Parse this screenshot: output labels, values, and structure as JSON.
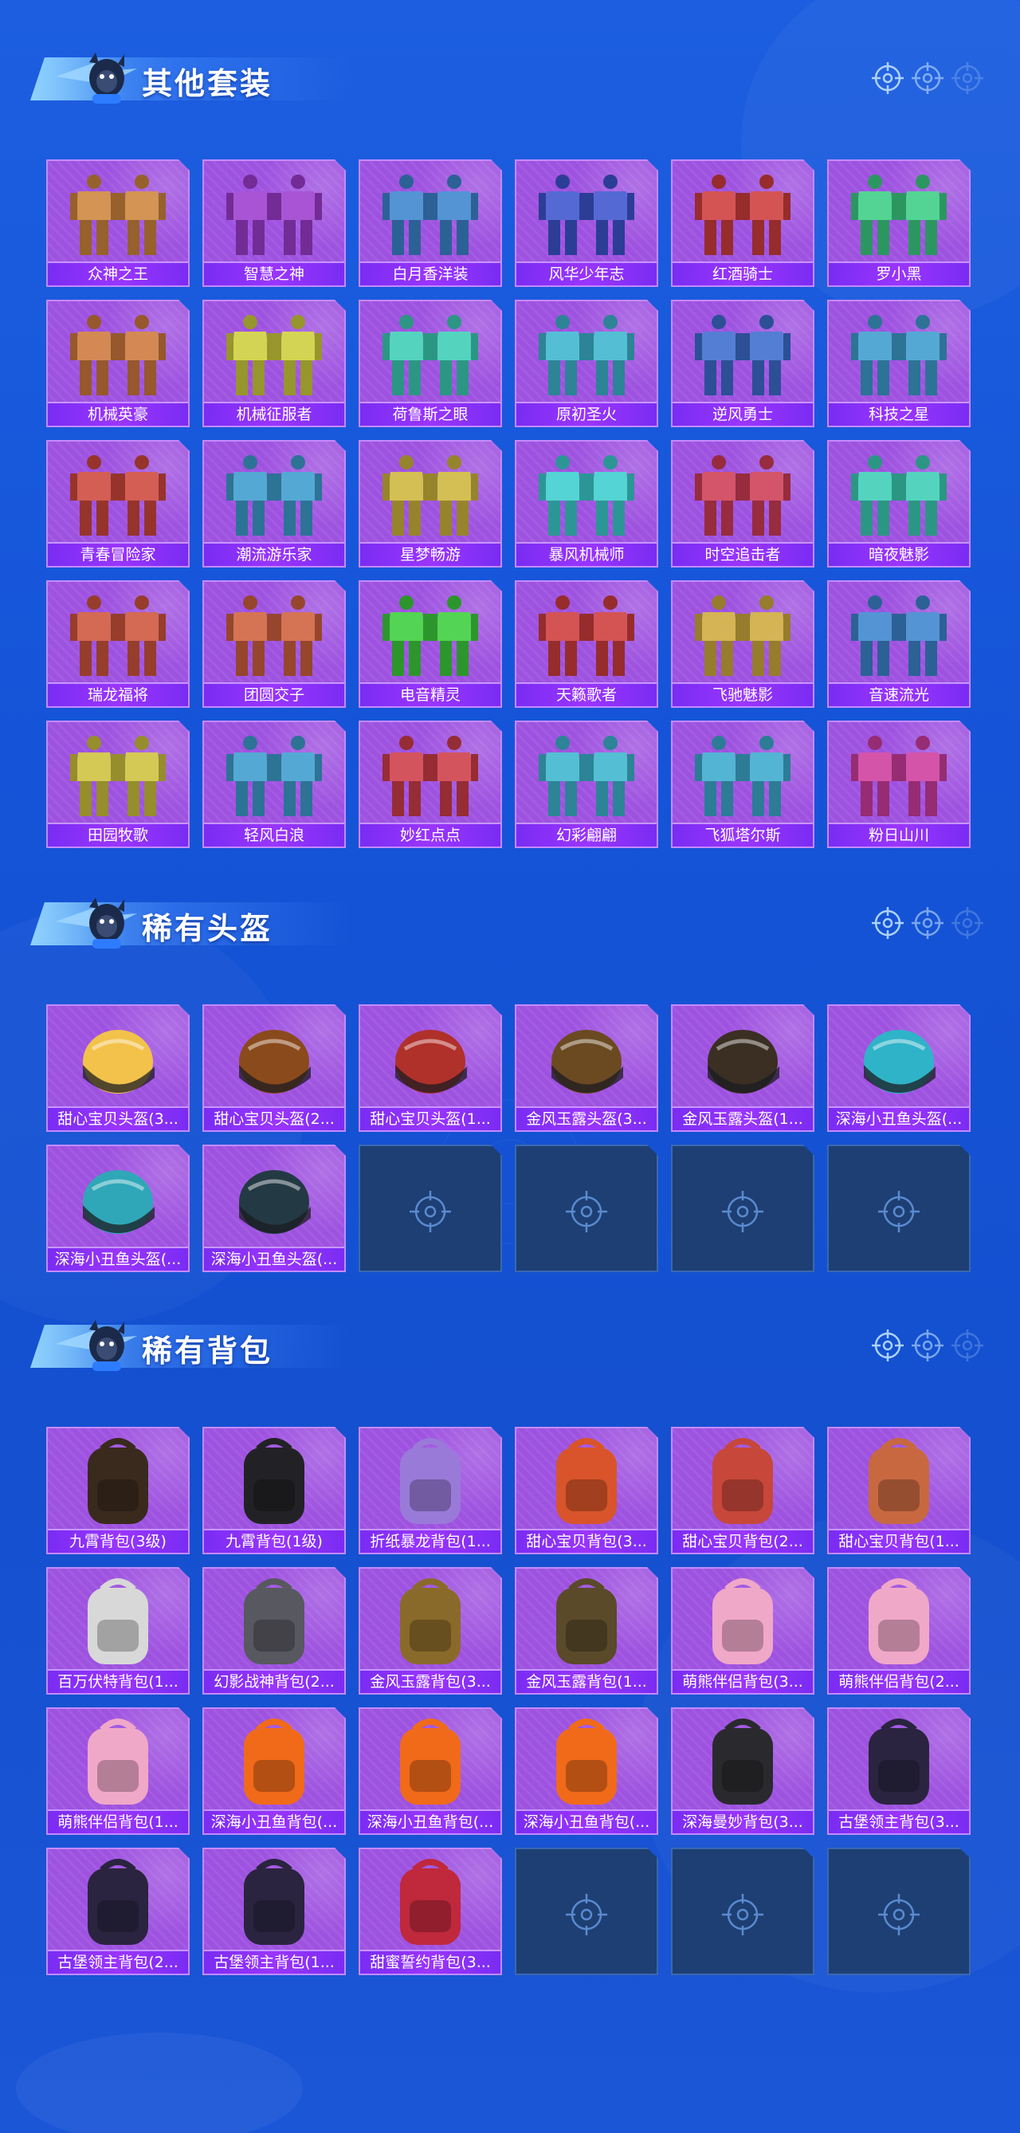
{
  "colors": {
    "background": "#1554d8",
    "card": "#9e52e0",
    "label_bar": "#8a30f8",
    "empty_slot": "#1e3f73"
  },
  "sections": [
    {
      "title": "其他套装",
      "items": [
        {
          "name": "众神之王",
          "art": "outfit"
        },
        {
          "name": "智慧之神",
          "art": "outfit"
        },
        {
          "name": "白月香洋装",
          "art": "outfit"
        },
        {
          "name": "风华少年志",
          "art": "outfit"
        },
        {
          "name": "红酒骑士",
          "art": "outfit"
        },
        {
          "name": "罗小黑",
          "art": "outfit"
        },
        {
          "name": "机械英豪",
          "art": "outfit"
        },
        {
          "name": "机械征服者",
          "art": "outfit"
        },
        {
          "name": "荷鲁斯之眼",
          "art": "outfit"
        },
        {
          "name": "原初圣火",
          "art": "outfit"
        },
        {
          "name": "逆风勇士",
          "art": "outfit"
        },
        {
          "name": "科技之星",
          "art": "outfit"
        },
        {
          "name": "青春冒险家",
          "art": "outfit"
        },
        {
          "name": "潮流游乐家",
          "art": "outfit"
        },
        {
          "name": "星梦畅游",
          "art": "outfit"
        },
        {
          "name": "暴风机械师",
          "art": "outfit"
        },
        {
          "name": "时空追击者",
          "art": "outfit"
        },
        {
          "name": "暗夜魅影",
          "art": "outfit"
        },
        {
          "name": "瑞龙福将",
          "art": "outfit"
        },
        {
          "name": "团圆交子",
          "art": "outfit"
        },
        {
          "name": "电音精灵",
          "art": "outfit"
        },
        {
          "name": "天籁歌者",
          "art": "outfit"
        },
        {
          "name": "飞驰魅影",
          "art": "outfit"
        },
        {
          "name": "音速流光",
          "art": "outfit"
        },
        {
          "name": "田园牧歌",
          "art": "outfit"
        },
        {
          "name": "轻风白浪",
          "art": "outfit"
        },
        {
          "name": "妙红点点",
          "art": "outfit"
        },
        {
          "name": "幻彩翩翩",
          "art": "outfit"
        },
        {
          "name": "飞狐塔尔斯",
          "art": "outfit"
        },
        {
          "name": "粉日山川",
          "art": "outfit"
        }
      ]
    },
    {
      "title": "稀有头盔",
      "items": [
        {
          "name": "甜心宝贝头盔(3...",
          "art": "helmet"
        },
        {
          "name": "甜心宝贝头盔(2...",
          "art": "helmet"
        },
        {
          "name": "甜心宝贝头盔(1...",
          "art": "helmet"
        },
        {
          "name": "金风玉露头盔(3...",
          "art": "helmet"
        },
        {
          "name": "金风玉露头盔(1...",
          "art": "helmet"
        },
        {
          "name": "深海小丑鱼头盔(...",
          "art": "helmet"
        },
        {
          "name": "深海小丑鱼头盔(...",
          "art": "helmet"
        },
        {
          "name": "深海小丑鱼头盔(...",
          "art": "helmet"
        },
        {
          "name": "",
          "art": "empty"
        },
        {
          "name": "",
          "art": "empty"
        },
        {
          "name": "",
          "art": "empty"
        },
        {
          "name": "",
          "art": "empty"
        }
      ]
    },
    {
      "title": "稀有背包",
      "items": [
        {
          "name": "九霄背包(3级)",
          "art": "backpack"
        },
        {
          "name": "九霄背包(1级)",
          "art": "backpack"
        },
        {
          "name": "折纸暴龙背包(1...",
          "art": "backpack"
        },
        {
          "name": "甜心宝贝背包(3...",
          "art": "backpack"
        },
        {
          "name": "甜心宝贝背包(2...",
          "art": "backpack"
        },
        {
          "name": "甜心宝贝背包(1...",
          "art": "backpack"
        },
        {
          "name": "百万伏特背包(1...",
          "art": "backpack"
        },
        {
          "name": "幻影战神背包(2...",
          "art": "backpack"
        },
        {
          "name": "金风玉露背包(3...",
          "art": "backpack"
        },
        {
          "name": "金风玉露背包(1...",
          "art": "backpack"
        },
        {
          "name": "萌熊伴侣背包(3...",
          "art": "backpack"
        },
        {
          "name": "萌熊伴侣背包(2...",
          "art": "backpack"
        },
        {
          "name": "萌熊伴侣背包(1...",
          "art": "backpack"
        },
        {
          "name": "深海小丑鱼背包(...",
          "art": "backpack"
        },
        {
          "name": "深海小丑鱼背包(...",
          "art": "backpack"
        },
        {
          "name": "深海小丑鱼背包(...",
          "art": "backpack"
        },
        {
          "name": "深海曼妙背包(3...",
          "art": "backpack"
        },
        {
          "name": "古堡领主背包(3...",
          "art": "backpack"
        },
        {
          "name": "古堡领主背包(2...",
          "art": "backpack"
        },
        {
          "name": "古堡领主背包(1...",
          "art": "backpack"
        },
        {
          "name": "甜蜜誓约背包(3...",
          "art": "backpack"
        },
        {
          "name": "",
          "art": "empty"
        },
        {
          "name": "",
          "art": "empty"
        },
        {
          "name": "",
          "art": "empty"
        }
      ]
    }
  ]
}
